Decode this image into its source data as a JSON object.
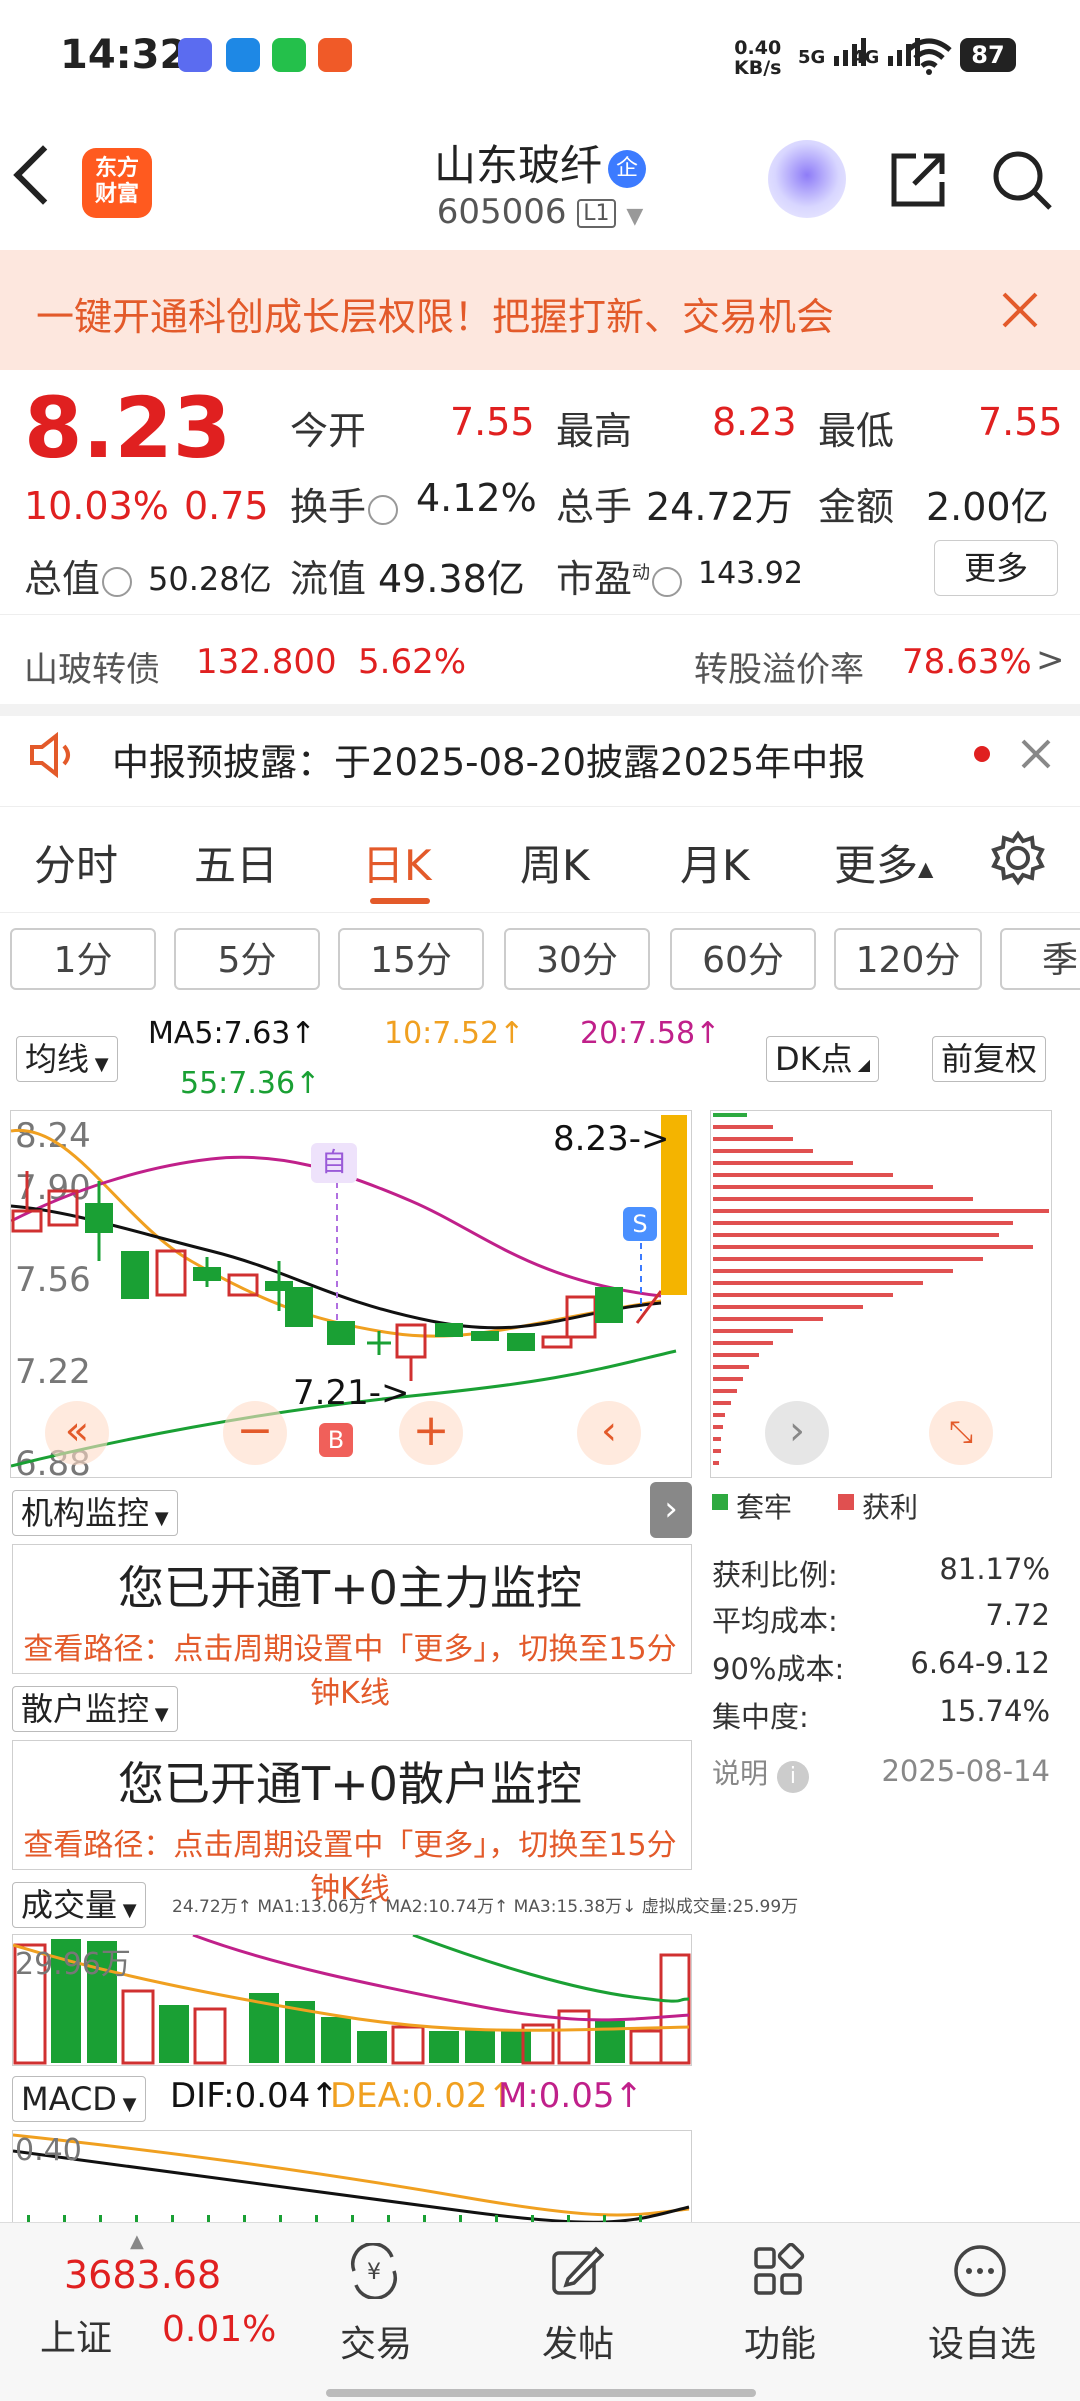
{
  "status": {
    "time": "14:32",
    "net_speed": "0.40",
    "net_unit": "KB/s",
    "net5g": "5G",
    "net4g": "4G",
    "battery": "87"
  },
  "header": {
    "logo_line1": "东方",
    "logo_line2": "财富",
    "title": "山东玻纤",
    "badge": "企",
    "code": "605006",
    "level": "L1"
  },
  "banner": {
    "text": "一键开通科创成长层权限！把握打新、交易机会"
  },
  "quote": {
    "price": "8.23",
    "pct": "10.03%",
    "chg": "0.75",
    "open_label": "今开",
    "open": "7.55",
    "high_label": "最高",
    "high": "8.23",
    "low_label": "最低",
    "low": "7.55",
    "turnover_label": "换手",
    "turnover": "4.12%",
    "volume_label": "总手",
    "volume": "24.72万",
    "amount_label": "金额",
    "amount": "2.00亿",
    "mktcap_label": "总值",
    "mktcap": "50.28亿",
    "float_label": "流值",
    "float": "49.38亿",
    "pe_label": "市盈",
    "pe_sup": "动",
    "pe": "143.92",
    "more_label": "更多"
  },
  "bond": {
    "name": "山玻转债",
    "price": "132.800",
    "pct": "5.62%",
    "premium_label": "转股溢价率",
    "premium": "78.63%",
    "arrow": ">"
  },
  "notice": {
    "text": "中报预披露：于2025-08-20披露2025年中报"
  },
  "tabs": [
    "分时",
    "五日",
    "日K",
    "周K",
    "月K",
    "更多"
  ],
  "periods": [
    "1分",
    "5分",
    "15分",
    "30分",
    "60分",
    "120分",
    "季"
  ],
  "ma": {
    "selector": "均线",
    "ma5": "MA5:7.63",
    "ma10": "10:7.52",
    "ma20": "20:7.58",
    "ma55": "55:7.36",
    "dk": "DK点",
    "adjust": "前复权",
    "ma5_color": "#111111",
    "ma10_color": "#f0a020",
    "ma20_color": "#c0208a",
    "ma55_color": "#1aa034"
  },
  "kchart": {
    "y_labels": [
      "8.24",
      "7.90",
      "7.56",
      "7.22",
      "6.88"
    ],
    "max_label": "8.23->",
    "min_label": "7.21->",
    "self_tag": "自",
    "s_tag": "S",
    "b_tag": "B"
  },
  "chip": {
    "legend_trapped": "套牢",
    "legend_profit": "获利",
    "stats": [
      {
        "label": "获利比例:",
        "value": "81.17%"
      },
      {
        "label": "平均成本:",
        "value": "7.72"
      },
      {
        "label": "90%成本:",
        "value": "6.64-9.12"
      },
      {
        "label": "集中度:",
        "value": "15.74%"
      }
    ],
    "note_label": "说明",
    "date": "2025-08-14"
  },
  "inst": {
    "selector": "机构监控",
    "title": "您已开通T+0主力监控",
    "sub": "查看路径：点击周期设置中「更多」，切换至15分钟K线"
  },
  "retail": {
    "selector": "散户监控",
    "title": "您已开通T+0散户监控",
    "sub": "查看路径：点击周期设置中「更多」，切换至15分钟K线"
  },
  "vol": {
    "selector": "成交量",
    "legend": "24.72万↑  MA1:13.06万↑  MA2:10.74万↑  MA3:15.38万↓  虚拟成交量:25.99万",
    "ylabel": "29.96万"
  },
  "macd": {
    "selector": "MACD",
    "dif": "DIF:0.04",
    "dea": "DEA:0.02",
    "m": "M:0.05",
    "ylabel": "0.40"
  },
  "bottom": {
    "index_value": "3683.68",
    "index_name": "上证",
    "index_pct": "0.01%",
    "items": [
      "交易",
      "发帖",
      "功能",
      "设自选"
    ]
  }
}
